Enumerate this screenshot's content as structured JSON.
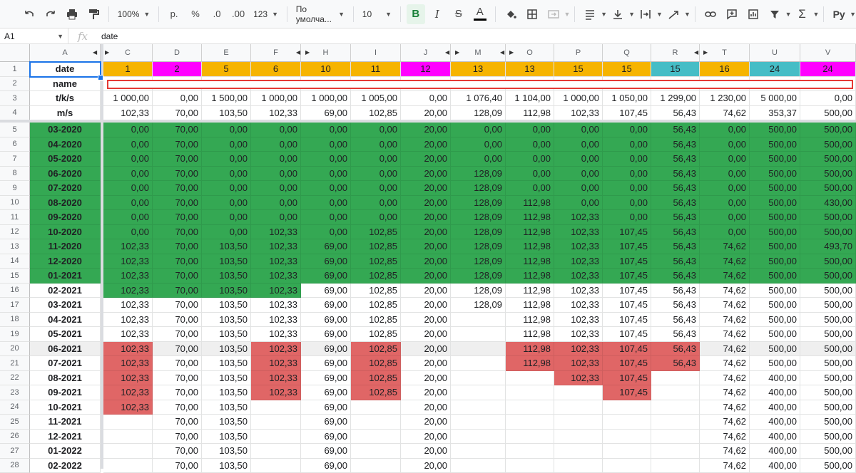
{
  "toolbar": {
    "zoom": "100%",
    "currency": "р.",
    "percent": "%",
    "dec_less": ".0",
    "dec_more": ".00",
    "more_formats": "123",
    "font": "По умолча...",
    "font_size": "10",
    "bold": "B",
    "italic": "I",
    "strike": "S",
    "text_color": "A",
    "input_tools": "Рy"
  },
  "formula_bar": {
    "cell_ref": "A1",
    "fx": "fx",
    "value": "date"
  },
  "columns": [
    {
      "letter": "A"
    },
    {
      "letter": "C"
    },
    {
      "letter": "D"
    },
    {
      "letter": "E"
    },
    {
      "letter": "F"
    },
    {
      "letter": "H"
    },
    {
      "letter": "I"
    },
    {
      "letter": "J"
    },
    {
      "letter": "M"
    },
    {
      "letter": "O"
    },
    {
      "letter": "P"
    },
    {
      "letter": "Q"
    },
    {
      "letter": "R"
    },
    {
      "letter": "T"
    },
    {
      "letter": "U"
    },
    {
      "letter": "V"
    }
  ],
  "colors": {
    "orange": "#f6b400",
    "magenta": "#ff00ff",
    "teal": "#46bdc6",
    "green": "#34a853",
    "red": "#e06666",
    "gray": "#efefef"
  },
  "header_colors": [
    "",
    "orange",
    "magenta",
    "orange",
    "orange",
    "orange",
    "orange",
    "magenta",
    "orange",
    "orange",
    "orange",
    "orange",
    "teal",
    "orange",
    "teal",
    "magenta"
  ],
  "rows": [
    {
      "num": "1",
      "cells": [
        "date",
        "1",
        "2",
        "5",
        "6",
        "10",
        "11",
        "12",
        "13",
        "13",
        "15",
        "15",
        "15",
        "16",
        "24",
        "24"
      ]
    },
    {
      "num": "2",
      "cells": [
        "name",
        "",
        "",
        "",
        "",
        "",
        "",
        "",
        "",
        "",
        "",
        "",
        "",
        "",
        "",
        ""
      ]
    },
    {
      "num": "3",
      "cells": [
        "t/k/s",
        "1 000,00",
        "0,00",
        "1 500,00",
        "1 000,00",
        "1 000,00",
        "1 005,00",
        "0,00",
        "1 076,40",
        "1 104,00",
        "1 000,00",
        "1 050,00",
        "1 299,00",
        "1 230,00",
        "5 000,00",
        "0,00"
      ]
    },
    {
      "num": "4",
      "cells": [
        "m/s",
        "102,33",
        "70,00",
        "103,50",
        "102,33",
        "69,00",
        "102,85",
        "20,00",
        "128,09",
        "112,98",
        "102,33",
        "107,45",
        "56,43",
        "74,62",
        "353,37",
        "500,00"
      ]
    },
    {
      "num": "5",
      "cells": [
        "03-2020",
        "0,00",
        "70,00",
        "0,00",
        "0,00",
        "0,00",
        "0,00",
        "20,00",
        "0,00",
        "0,00",
        "0,00",
        "0,00",
        "56,43",
        "0,00",
        "500,00",
        "500,00"
      ]
    },
    {
      "num": "6",
      "cells": [
        "04-2020",
        "0,00",
        "70,00",
        "0,00",
        "0,00",
        "0,00",
        "0,00",
        "20,00",
        "0,00",
        "0,00",
        "0,00",
        "0,00",
        "56,43",
        "0,00",
        "500,00",
        "500,00"
      ]
    },
    {
      "num": "7",
      "cells": [
        "05-2020",
        "0,00",
        "70,00",
        "0,00",
        "0,00",
        "0,00",
        "0,00",
        "20,00",
        "0,00",
        "0,00",
        "0,00",
        "0,00",
        "56,43",
        "0,00",
        "500,00",
        "500,00"
      ]
    },
    {
      "num": "8",
      "cells": [
        "06-2020",
        "0,00",
        "70,00",
        "0,00",
        "0,00",
        "0,00",
        "0,00",
        "20,00",
        "128,09",
        "0,00",
        "0,00",
        "0,00",
        "56,43",
        "0,00",
        "500,00",
        "500,00"
      ]
    },
    {
      "num": "9",
      "cells": [
        "07-2020",
        "0,00",
        "70,00",
        "0,00",
        "0,00",
        "0,00",
        "0,00",
        "20,00",
        "128,09",
        "0,00",
        "0,00",
        "0,00",
        "56,43",
        "0,00",
        "500,00",
        "500,00"
      ]
    },
    {
      "num": "10",
      "cells": [
        "08-2020",
        "0,00",
        "70,00",
        "0,00",
        "0,00",
        "0,00",
        "0,00",
        "20,00",
        "128,09",
        "112,98",
        "0,00",
        "0,00",
        "56,43",
        "0,00",
        "500,00",
        "430,00"
      ]
    },
    {
      "num": "11",
      "cells": [
        "09-2020",
        "0,00",
        "70,00",
        "0,00",
        "0,00",
        "0,00",
        "0,00",
        "20,00",
        "128,09",
        "112,98",
        "102,33",
        "0,00",
        "56,43",
        "0,00",
        "500,00",
        "500,00"
      ]
    },
    {
      "num": "12",
      "cells": [
        "10-2020",
        "0,00",
        "70,00",
        "0,00",
        "102,33",
        "0,00",
        "102,85",
        "20,00",
        "128,09",
        "112,98",
        "102,33",
        "107,45",
        "56,43",
        "0,00",
        "500,00",
        "500,00"
      ]
    },
    {
      "num": "13",
      "cells": [
        "11-2020",
        "102,33",
        "70,00",
        "103,50",
        "102,33",
        "69,00",
        "102,85",
        "20,00",
        "128,09",
        "112,98",
        "102,33",
        "107,45",
        "56,43",
        "74,62",
        "500,00",
        "493,70"
      ]
    },
    {
      "num": "14",
      "cells": [
        "12-2020",
        "102,33",
        "70,00",
        "103,50",
        "102,33",
        "69,00",
        "102,85",
        "20,00",
        "128,09",
        "112,98",
        "102,33",
        "107,45",
        "56,43",
        "74,62",
        "500,00",
        "500,00"
      ]
    },
    {
      "num": "15",
      "cells": [
        "01-2021",
        "102,33",
        "70,00",
        "103,50",
        "102,33",
        "69,00",
        "102,85",
        "20,00",
        "128,09",
        "112,98",
        "102,33",
        "107,45",
        "56,43",
        "74,62",
        "500,00",
        "500,00"
      ]
    },
    {
      "num": "16",
      "cells": [
        "02-2021",
        "102,33",
        "70,00",
        "103,50",
        "102,33",
        "69,00",
        "102,85",
        "20,00",
        "128,09",
        "112,98",
        "102,33",
        "107,45",
        "56,43",
        "74,62",
        "500,00",
        "500,00"
      ]
    },
    {
      "num": "17",
      "cells": [
        "03-2021",
        "102,33",
        "70,00",
        "103,50",
        "102,33",
        "69,00",
        "102,85",
        "20,00",
        "128,09",
        "112,98",
        "102,33",
        "107,45",
        "56,43",
        "74,62",
        "500,00",
        "500,00"
      ]
    },
    {
      "num": "18",
      "cells": [
        "04-2021",
        "102,33",
        "70,00",
        "103,50",
        "102,33",
        "69,00",
        "102,85",
        "20,00",
        "",
        "112,98",
        "102,33",
        "107,45",
        "56,43",
        "74,62",
        "500,00",
        "500,00"
      ]
    },
    {
      "num": "19",
      "cells": [
        "05-2021",
        "102,33",
        "70,00",
        "103,50",
        "102,33",
        "69,00",
        "102,85",
        "20,00",
        "",
        "112,98",
        "102,33",
        "107,45",
        "56,43",
        "74,62",
        "500,00",
        "500,00"
      ]
    },
    {
      "num": "20",
      "cells": [
        "06-2021",
        "102,33",
        "70,00",
        "103,50",
        "102,33",
        "69,00",
        "102,85",
        "20,00",
        "",
        "112,98",
        "102,33",
        "107,45",
        "56,43",
        "74,62",
        "500,00",
        "500,00"
      ]
    },
    {
      "num": "21",
      "cells": [
        "07-2021",
        "102,33",
        "70,00",
        "103,50",
        "102,33",
        "69,00",
        "102,85",
        "20,00",
        "",
        "112,98",
        "102,33",
        "107,45",
        "56,43",
        "74,62",
        "500,00",
        "500,00"
      ]
    },
    {
      "num": "22",
      "cells": [
        "08-2021",
        "102,33",
        "70,00",
        "103,50",
        "102,33",
        "69,00",
        "102,85",
        "20,00",
        "",
        "",
        "102,33",
        "107,45",
        "",
        "74,62",
        "400,00",
        "500,00"
      ]
    },
    {
      "num": "23",
      "cells": [
        "09-2021",
        "102,33",
        "70,00",
        "103,50",
        "102,33",
        "69,00",
        "102,85",
        "20,00",
        "",
        "",
        "",
        "107,45",
        "",
        "74,62",
        "400,00",
        "500,00"
      ]
    },
    {
      "num": "24",
      "cells": [
        "10-2021",
        "102,33",
        "70,00",
        "103,50",
        "",
        "69,00",
        "",
        "20,00",
        "",
        "",
        "",
        "",
        "",
        "74,62",
        "400,00",
        "500,00"
      ]
    },
    {
      "num": "25",
      "cells": [
        "11-2021",
        "",
        "70,00",
        "103,50",
        "",
        "69,00",
        "",
        "20,00",
        "",
        "",
        "",
        "",
        "",
        "74,62",
        "400,00",
        "500,00"
      ]
    },
    {
      "num": "26",
      "cells": [
        "12-2021",
        "",
        "70,00",
        "103,50",
        "",
        "69,00",
        "",
        "20,00",
        "",
        "",
        "",
        "",
        "",
        "74,62",
        "400,00",
        "500,00"
      ]
    },
    {
      "num": "27",
      "cells": [
        "01-2022",
        "",
        "70,00",
        "103,50",
        "",
        "69,00",
        "",
        "20,00",
        "",
        "",
        "",
        "",
        "",
        "74,62",
        "400,00",
        "500,00"
      ]
    },
    {
      "num": "28",
      "cells": [
        "02-2022",
        "",
        "70,00",
        "103,50",
        "",
        "69,00",
        "",
        "20,00",
        "",
        "",
        "",
        "",
        "",
        "74,62",
        "400,00",
        "500,00"
      ]
    }
  ],
  "cell_colors": {
    "green_rows": [
      5,
      6,
      7,
      8,
      9,
      10,
      11,
      12,
      13,
      14,
      15
    ],
    "green_row16_cols": [
      1,
      2,
      3,
      4
    ],
    "red": [
      [
        20,
        1
      ],
      [
        20,
        4
      ],
      [
        20,
        6
      ],
      [
        20,
        9
      ],
      [
        20,
        10
      ],
      [
        20,
        11
      ],
      [
        20,
        12
      ],
      [
        21,
        1
      ],
      [
        21,
        4
      ],
      [
        21,
        6
      ],
      [
        21,
        9
      ],
      [
        21,
        10
      ],
      [
        21,
        11
      ],
      [
        21,
        12
      ],
      [
        22,
        1
      ],
      [
        22,
        4
      ],
      [
        22,
        6
      ],
      [
        22,
        10
      ],
      [
        22,
        11
      ],
      [
        23,
        1
      ],
      [
        23,
        4
      ],
      [
        23,
        6
      ],
      [
        23,
        11
      ],
      [
        24,
        1
      ]
    ],
    "gray_row": 20
  }
}
